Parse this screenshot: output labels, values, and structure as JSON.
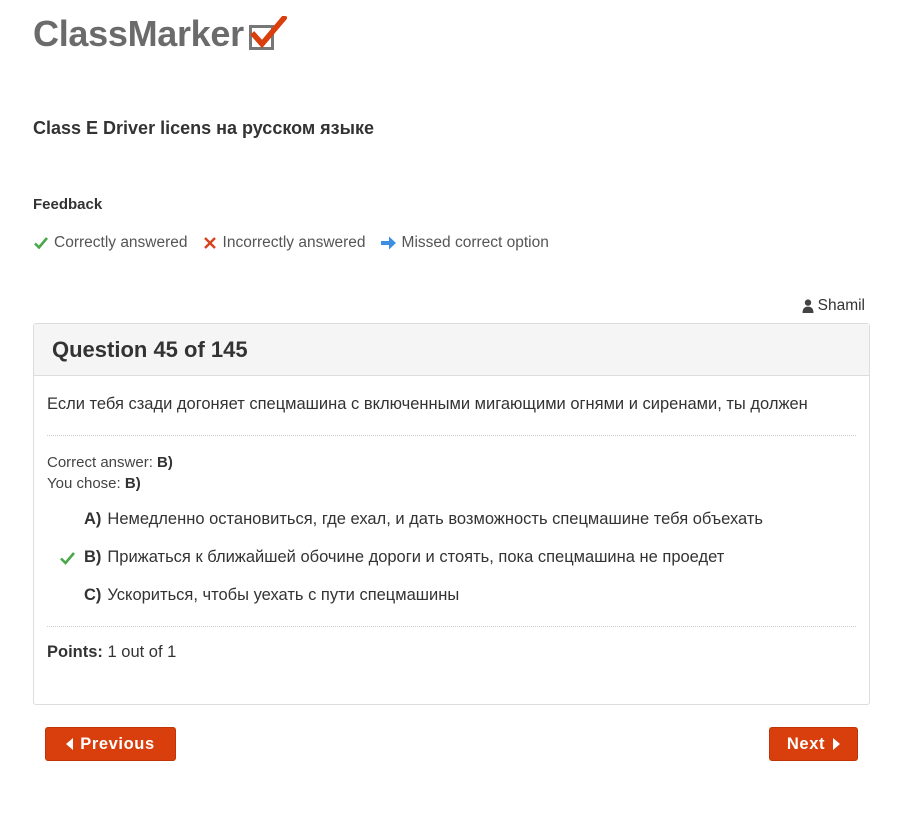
{
  "logo": {
    "text": "ClassMarker"
  },
  "test": {
    "title": "Class E Driver licens на русском языке"
  },
  "feedback": {
    "label": "Feedback",
    "legend": {
      "correct": "Correctly answered",
      "incorrect": "Incorrectly answered",
      "missed": "Missed correct option"
    }
  },
  "user": {
    "name": "Shamil"
  },
  "question": {
    "header": "Question 45 of 145",
    "text": "Если тебя сзади догоняет спецмашина с включенными мигающими огнями и сиренами, ты должен",
    "correct_answer_label": "Correct answer:",
    "correct_answer_value": "B)",
    "you_chose_label": "You chose:",
    "you_chose_value": "B)",
    "options": [
      {
        "letter": "A)",
        "text": "Немедленно остановиться, где ехал, и дать возможность спецмашине тебя объехать"
      },
      {
        "letter": "B)",
        "text": "Прижаться к ближайшей обочине дороги и стоять, пока спецмашина не проедет"
      },
      {
        "letter": "C)",
        "text": "Ускориться, чтобы уехать с пути спецмашины"
      }
    ],
    "points_label": "Points:",
    "points_value": "1 out of 1"
  },
  "nav": {
    "previous_label": "Previous",
    "next_label": "Next"
  },
  "colors": {
    "correct_green": "#4aa84a",
    "incorrect_red": "#d9411e",
    "missed_blue": "#3c8fe0",
    "button_orange": "#d93f0c"
  },
  "icons": {
    "logo_mark": "checkbox-check-icon",
    "correct": "check-icon",
    "incorrect": "x-icon",
    "missed": "arrow-right-icon",
    "user": "user-icon",
    "prev": "caret-left-icon",
    "next": "caret-right-icon"
  }
}
